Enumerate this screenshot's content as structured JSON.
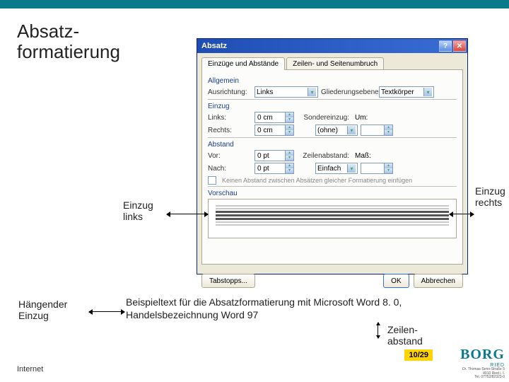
{
  "title": "Absatzformatierung",
  "dialog": {
    "title": "Absatz",
    "tabs": {
      "active": "Einzüge und Abstände",
      "other": "Zeilen- und Seitenumbruch"
    },
    "section_general": "Allgemein",
    "alignment_label": "Ausrichtung:",
    "alignment_value": "Links",
    "outline_label": "Gliederungsebene:",
    "outline_value": "Textkörper",
    "section_indent": "Einzug",
    "left_label": "Links:",
    "left_value": "0 cm",
    "right_label": "Rechts:",
    "right_value": "0 cm",
    "special_label": "Sondereinzug:",
    "special_value": "(ohne)",
    "by_label": "Um:",
    "section_spacing": "Abstand",
    "before_label": "Vor:",
    "before_value": "0 pt",
    "after_label": "Nach:",
    "after_value": "0 pt",
    "linespacing_label": "Zeilenabstand:",
    "linespacing_value": "Einfach",
    "at_label": "Maß:",
    "checkbox_label": "Keinen Abstand zwischen Absätzen gleicher Formatierung einfügen",
    "preview_label": "Vorschau",
    "btn_tabs": "Tabstopps...",
    "btn_ok": "OK",
    "btn_cancel": "Abbrechen"
  },
  "annotations": {
    "left": "Einzug links",
    "right": "Einzug rechts",
    "hanging": "Hängender Einzug",
    "linespace": "Zeilenabstand",
    "example": "Beispieltext für die Absatzformatierung mit Microsoft Word 8. 0, Handelsbezeichnung Word 97"
  },
  "footer": {
    "page": "10/29",
    "internet": "Internet",
    "logo_main": "BORG",
    "logo_sub": "RIED"
  }
}
